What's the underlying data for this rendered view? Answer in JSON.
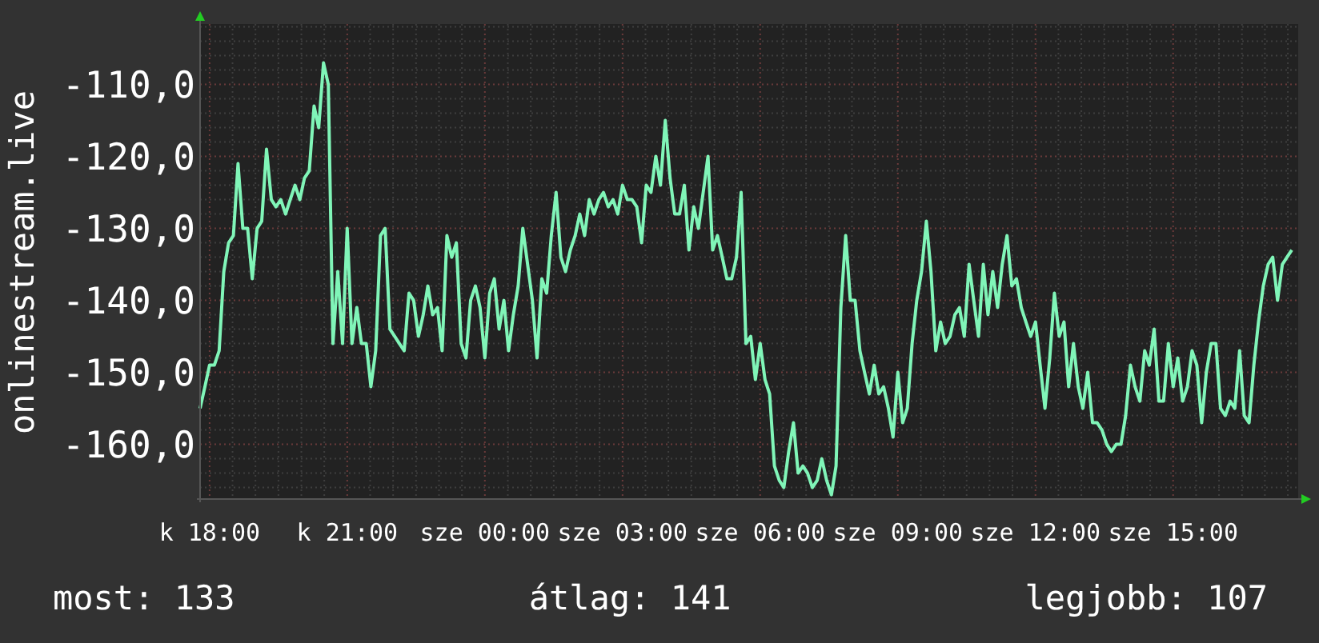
{
  "graph": {
    "chart_data": {
      "type": "line",
      "ylabel": "onlinestream.live",
      "grid": true,
      "ylim": [
        -167.6,
        -101.6
      ],
      "categories": [
        null,
        null,
        "k 18:00",
        null,
        null,
        null,
        null,
        null,
        null,
        null,
        null,
        null,
        null,
        null,
        null,
        null,
        null,
        null,
        null,
        null,
        null,
        null,
        null,
        null,
        null,
        null,
        null,
        null,
        null,
        null,
        null,
        "k 21:00",
        null,
        null,
        null,
        null,
        null,
        null,
        null,
        null,
        null,
        null,
        null,
        null,
        null,
        null,
        null,
        null,
        null,
        null,
        null,
        null,
        null,
        null,
        null,
        null,
        null,
        null,
        null,
        null,
        "sze 00:00",
        null,
        null,
        null,
        null,
        null,
        null,
        null,
        null,
        null,
        null,
        null,
        null,
        null,
        null,
        null,
        null,
        null,
        null,
        null,
        null,
        null,
        null,
        null,
        null,
        null,
        null,
        null,
        null,
        "sze 03:00",
        null,
        null,
        null,
        null,
        null,
        null,
        null,
        null,
        null,
        null,
        null,
        null,
        null,
        null,
        null,
        null,
        null,
        null,
        null,
        null,
        null,
        null,
        null,
        null,
        null,
        null,
        null,
        null,
        "sze 06:00",
        null,
        null,
        null,
        null,
        null,
        null,
        null,
        null,
        null,
        null,
        null,
        null,
        null,
        null,
        null,
        null,
        null,
        null,
        null,
        null,
        null,
        null,
        null,
        null,
        null,
        null,
        null,
        null,
        "sze 09:00",
        null,
        null,
        null,
        null,
        null,
        null,
        null,
        null,
        null,
        null,
        null,
        null,
        null,
        null,
        null,
        null,
        null,
        null,
        null,
        null,
        null,
        null,
        null,
        null,
        null,
        null,
        null,
        null,
        "sze 12:00",
        null,
        null,
        null,
        null,
        null,
        null,
        null,
        null,
        null,
        null,
        null,
        null,
        null,
        null,
        null,
        null,
        null,
        null,
        null,
        null,
        null,
        null,
        null,
        null,
        null,
        null,
        null,
        null,
        "sze 15:00",
        null,
        null,
        null,
        null,
        null,
        null,
        null,
        null,
        null,
        null,
        null,
        null,
        null,
        null,
        null,
        null,
        null,
        null,
        null,
        null,
        null,
        null,
        null,
        null,
        null
      ],
      "yticks": [
        {
          "value": -110,
          "label": "-110,0"
        },
        {
          "value": -120,
          "label": "-120,0"
        },
        {
          "value": -130,
          "label": "-130,0"
        },
        {
          "value": -140,
          "label": "-140,0"
        },
        {
          "value": -150,
          "label": "-150,0"
        },
        {
          "value": -160,
          "label": "-160,0"
        }
      ],
      "series": [
        {
          "color": "#80f5b8",
          "values": [
            -155,
            -152,
            -149,
            -149,
            -147,
            -136,
            -132,
            -131,
            -121,
            -130,
            -130,
            -137,
            -130,
            -129,
            -119,
            -126,
            -127,
            -126,
            -128,
            -126,
            -124,
            -126,
            -123,
            -122,
            -113,
            -116,
            -107,
            -110,
            -146,
            -136,
            -146,
            -130,
            -146,
            -141,
            -146,
            -146,
            -152,
            -147,
            -131,
            -130,
            -144,
            -145,
            -146,
            -147,
            -139,
            -140,
            -145,
            -142,
            -138,
            -142,
            -141,
            -147,
            -131,
            -134,
            -132,
            -146,
            -148,
            -140,
            -138,
            -141,
            -148,
            -139,
            -137,
            -144,
            -140,
            -147,
            -142,
            -138,
            -130,
            -135,
            -140,
            -148,
            -137,
            -139,
            -131,
            -125,
            -134,
            -136,
            -133,
            -131,
            -128,
            -131,
            -126,
            -128,
            -126,
            -125,
            -127,
            -126,
            -128,
            -124,
            -126,
            -126,
            -127,
            -132,
            -124,
            -125,
            -120,
            -124,
            -115,
            -123,
            -128,
            -128,
            -124,
            -133,
            -127,
            -130,
            -125,
            -120,
            -133,
            -131,
            -134,
            -137,
            -137,
            -134,
            -125,
            -146,
            -145,
            -151,
            -146,
            -151,
            -153,
            -163,
            -165,
            -166,
            -161,
            -157,
            -164,
            -163,
            -164,
            -166,
            -165,
            -162,
            -165,
            -167,
            -163,
            -141,
            -131,
            -140,
            -140,
            -147,
            -150,
            -153,
            -149,
            -153,
            -152,
            -155,
            -159,
            -150,
            -157,
            -155,
            -146,
            -140,
            -136,
            -129,
            -136,
            -147,
            -143,
            -146,
            -145,
            -142,
            -141,
            -145,
            -135,
            -140,
            -145,
            -135,
            -142,
            -136,
            -141,
            -135,
            -131,
            -138,
            -137,
            -141,
            -143,
            -145,
            -143,
            -149,
            -155,
            -148,
            -139,
            -145,
            -143,
            -152,
            -146,
            -152,
            -155,
            -150,
            -157,
            -157,
            -158,
            -160,
            -161,
            -160,
            -160,
            -156,
            -149,
            -152,
            -154,
            -147,
            -149,
            -144,
            -154,
            -154,
            -146,
            -152,
            -148,
            -154,
            -152,
            -147,
            -149,
            -157,
            -150,
            -146,
            -146,
            -155,
            -156,
            -154,
            -155,
            -147,
            -156,
            -157,
            -149,
            -143,
            -138,
            -135,
            -134,
            -140,
            -135,
            -134,
            -133
          ]
        }
      ]
    }
  },
  "stats": [
    {
      "label": "most: 133"
    },
    {
      "label": "átlag: 141"
    },
    {
      "label": "legjobb: 107"
    }
  ]
}
